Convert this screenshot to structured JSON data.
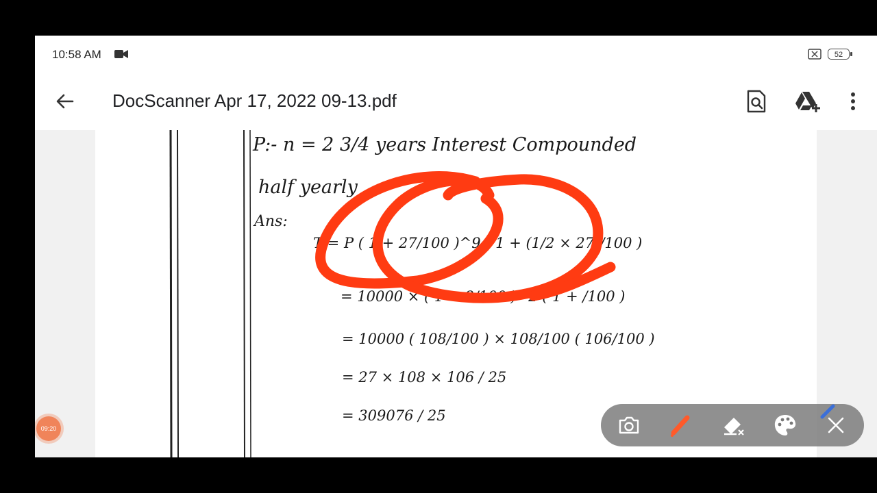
{
  "status_bar": {
    "time": "10:58 AM",
    "battery": "52"
  },
  "app_bar": {
    "title": "DocScanner Apr 17, 2022 09-13.pdf"
  },
  "icons": {
    "back": "arrow-left-icon",
    "find": "search-document-icon",
    "drive": "google-drive-add-icon",
    "more": "more-vert-icon",
    "camera": "camera-icon",
    "pen": "pen-icon",
    "eraser": "eraser-icon",
    "palette": "palette-icon",
    "close": "close-icon"
  },
  "colors": {
    "annotation": "#ff3b12",
    "toolbar_bg": "#787878"
  },
  "floating_bubble": {
    "label": "09:20"
  },
  "document": {
    "lines": [
      "P:- n = 2 3/4 years Interest Compounded",
      "half yearly",
      "Ans:",
      "T = P ( 1 + 27/100 )^9 ( 1 + (1/2 × 27)/100 )",
      "= 10000 × ( 1 + 8/100 )^2 ( 1 + /100 )",
      "= 10000 ( 108/100 ) × 108/100 ( 106/100 )",
      "= 27 × 108 × 106 / 25",
      "= 309076 / 25"
    ]
  }
}
